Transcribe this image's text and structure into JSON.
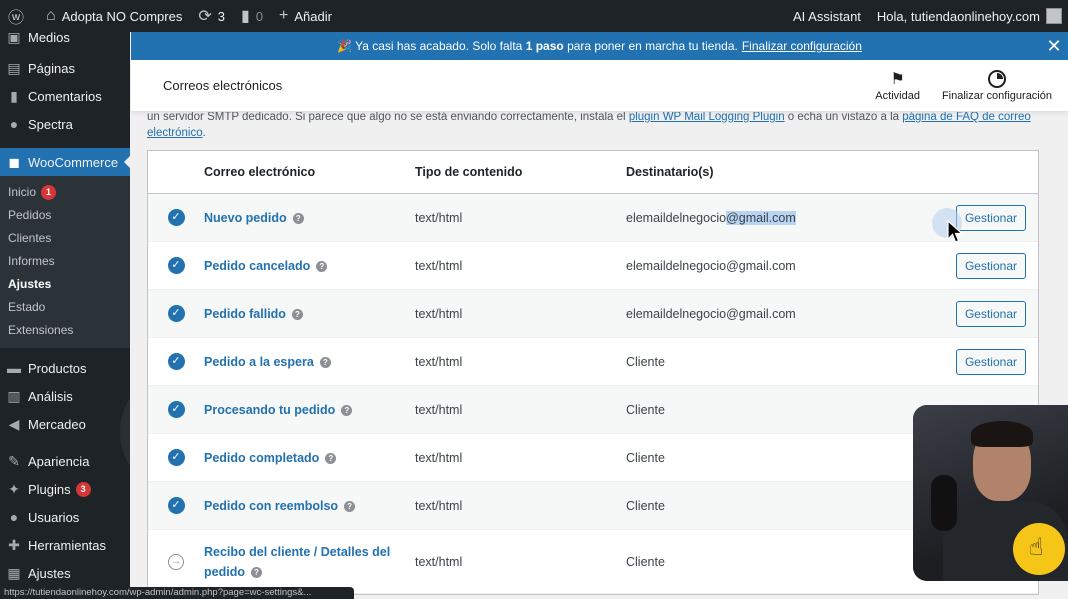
{
  "adminbar": {
    "site_name": "Adopta NO Compres",
    "updates_count": "3",
    "comments_count": "0",
    "add_new_label": "Añadir",
    "ai_assistant_label": "AI Assistant",
    "greeting": "Hola, tutiendaonlinehoy.com"
  },
  "sidebar": {
    "items_top": [
      "Medios",
      "Páginas",
      "Comentarios",
      "Spectra"
    ],
    "woocommerce_label": "WooCommerce",
    "submenu": {
      "inicio": "Inicio",
      "inicio_badge": "1",
      "pedidos": "Pedidos",
      "clientes": "Clientes",
      "informes": "Informes",
      "ajustes": "Ajustes",
      "estado": "Estado",
      "extensiones": "Extensiones"
    },
    "items_bottom": {
      "productos": "Productos",
      "analisis": "Análisis",
      "mercadeo": "Mercadeo",
      "apariencia": "Apariencia",
      "plugins": "Plugins",
      "plugins_badge": "3",
      "usuarios": "Usuarios",
      "herramientas": "Herramientas",
      "ajustes": "Ajustes"
    }
  },
  "notice": {
    "text_before": "🎉 Ya casi has acabado. Solo falta",
    "bold": "1 paso",
    "text_after": "para poner en marcha tu tienda.",
    "link": "Finalizar configuración"
  },
  "header": {
    "title": "Correos electrónicos",
    "activity_label": "Actividad",
    "finish_label": "Finalizar configuración"
  },
  "intro": {
    "text1": "un servidor SMTP dedicado. Si parece que algo no se está enviando correctamente, instala el",
    "link1": "plugin WP Mail Logging Plugin",
    "text2": "o echa un vistazo a la",
    "link2": "página de FAQ de correo electrónico",
    "text3": "."
  },
  "table": {
    "headers": {
      "name": "Correo electrónico",
      "type": "Tipo de contenido",
      "recipient": "Destinatario(s)"
    },
    "manage_label": "Gestionar",
    "rows": [
      {
        "name": "Nuevo pedido",
        "type": "text/html",
        "recipient_a": "elemaildelnegocio",
        "recipient_b": "@gmail.com",
        "status": "enabled"
      },
      {
        "name": "Pedido cancelado",
        "type": "text/html",
        "recipient": "elemaildelnegocio@gmail.com",
        "status": "enabled"
      },
      {
        "name": "Pedido fallido",
        "type": "text/html",
        "recipient": "elemaildelnegocio@gmail.com",
        "status": "enabled"
      },
      {
        "name": "Pedido a la espera",
        "type": "text/html",
        "recipient": "Cliente",
        "status": "enabled"
      },
      {
        "name": "Procesando tu pedido",
        "type": "text/html",
        "recipient": "Cliente",
        "status": "enabled"
      },
      {
        "name": "Pedido completado",
        "type": "text/html",
        "recipient": "Cliente",
        "status": "enabled"
      },
      {
        "name": "Pedido con reembolso",
        "type": "text/html",
        "recipient": "Cliente",
        "status": "enabled"
      },
      {
        "name_line1": "Recibo del cliente / Detalles del",
        "name_line2": "pedido",
        "type": "text/html",
        "recipient": "Cliente",
        "status": "manual"
      }
    ]
  },
  "statusbar": {
    "url": "https://tutiendaonlinehoy.com/wp-admin/admin.php?page=wc-settings&..."
  }
}
